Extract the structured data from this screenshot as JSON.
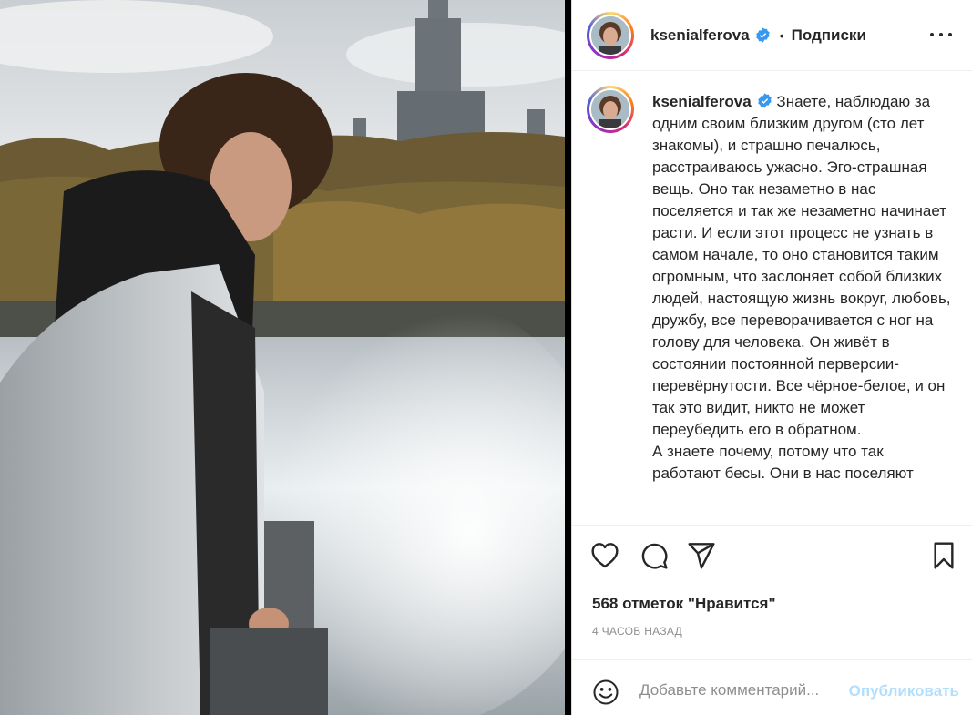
{
  "post": {
    "username": "ksenialferova",
    "verified": true,
    "follow_label": "Подписки",
    "separator": "•",
    "caption": "Знаете, наблюдаю за одним своим близким другом (сто лет знакомы), и страшно печалюсь, расстраиваюсь ужасно. Эго-страшная вещь. Оно так незаметно в нас поселяется и так же незаметно начинает расти. И если этот процесс не узнать в самом начале, то оно становится таким огромным, что заслоняет собой близких людей, настоящую жизнь вокруг, любовь, дружбу, все переворачивается с ног на голову для человека. Он живёт в состоянии постоянной перверсии-перевёрнутости. Все чёрное-белое, и он так это видит, никто не может переубедить его в обратном.\nА знаете почему, потому что так работают бесы. Они в нас поселяют",
    "likes": "568 отметок \"Нравится\"",
    "time_ago": "4 ЧАСОВ НАЗАД"
  },
  "comment": {
    "placeholder": "Добавьте комментарий...",
    "publish_label": "Опубликовать"
  },
  "icons": {
    "more": "more-options-icon",
    "like": "heart-icon",
    "comment": "comment-icon",
    "share": "paper-plane-icon",
    "save": "bookmark-icon",
    "emoji": "smiley-icon",
    "verified": "verified-badge-icon"
  },
  "colors": {
    "verified_blue": "#3897f0",
    "publish_disabled": "#b2dffc",
    "muted_text": "#8e8e8e"
  }
}
